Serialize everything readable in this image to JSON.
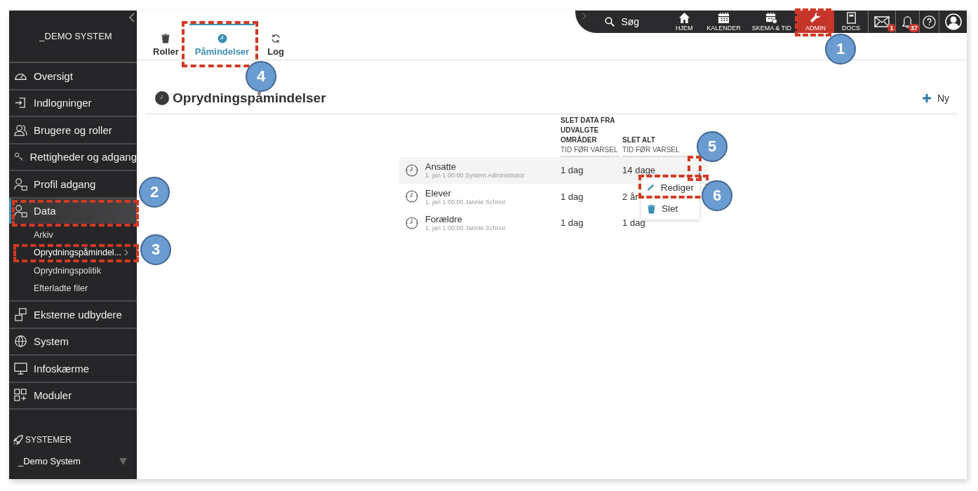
{
  "sidebar": {
    "title": "_DEMO SYSTEM",
    "items": [
      {
        "label": "Oversigt",
        "selected": false
      },
      {
        "label": "Indlogninger",
        "selected": false
      },
      {
        "label": "Brugere og roller",
        "selected": false
      },
      {
        "label": "Rettigheder og adgang",
        "selected": false
      },
      {
        "label": "Profil adgang",
        "selected": false
      },
      {
        "label": "Data",
        "selected": true,
        "expanded": true,
        "children": [
          {
            "label": "Arkiv",
            "selected": false
          },
          {
            "label": "Oprydningspåmindel...",
            "selected": true
          },
          {
            "label": "Oprydningspolitik",
            "selected": false
          },
          {
            "label": "Efterladte filer",
            "selected": false
          }
        ]
      },
      {
        "label": "Eksterne udbydere",
        "selected": false
      },
      {
        "label": "System",
        "selected": false
      },
      {
        "label": "Infoskærme",
        "selected": false
      },
      {
        "label": "Moduler",
        "selected": false
      }
    ],
    "section_title": "SYSTEMER",
    "system_select": "_Demo System"
  },
  "tabs": [
    {
      "label": "Roller",
      "selected": false
    },
    {
      "label": "Påmindelser",
      "selected": true
    },
    {
      "label": "Log",
      "selected": false
    }
  ],
  "top_nav": {
    "search": "Søg",
    "items": [
      {
        "label": "HJEM",
        "selected": false
      },
      {
        "label": "KALENDER",
        "selected": false
      },
      {
        "label": "SKEMA & TID",
        "selected": false
      },
      {
        "label": "ADMIN",
        "selected": true
      },
      {
        "label": "DOCS",
        "selected": false
      }
    ],
    "mail_badge": "1",
    "notification_badge": "37"
  },
  "page": {
    "title": "Oprydningspåmindelser",
    "new_button": "Ny"
  },
  "table": {
    "columns": [
      {
        "title": "SLET DATA FRA UDVALGTE OMRÅDER",
        "subtitle": "TID FØR VARSEL"
      },
      {
        "title": "SLET ALT",
        "subtitle": "TID FØR VARSEL"
      }
    ],
    "rows": [
      {
        "name": "Ansatte",
        "meta": "1. jan 1 00:00 System Administrator",
        "values": [
          "1 dag",
          "14 dage"
        ],
        "selected": true
      },
      {
        "name": "Elever",
        "meta": "1. jan 1 00:00 Jannie Schnor",
        "values": [
          "1 dag",
          "2 år"
        ],
        "selected": false
      },
      {
        "name": "Forældre",
        "meta": "1. jan 1 00:00 Jannie Schnor",
        "values": [
          "1 dag",
          "1 dag"
        ],
        "selected": false
      }
    ]
  },
  "context_menu": {
    "items": [
      {
        "label": "Rediger",
        "kind": "edit"
      },
      {
        "label": "Slet",
        "kind": "delete"
      }
    ]
  },
  "callouts": [
    {
      "number": "1"
    },
    {
      "number": "2"
    },
    {
      "number": "3"
    },
    {
      "number": "4"
    },
    {
      "number": "5"
    },
    {
      "number": "6"
    }
  ]
}
